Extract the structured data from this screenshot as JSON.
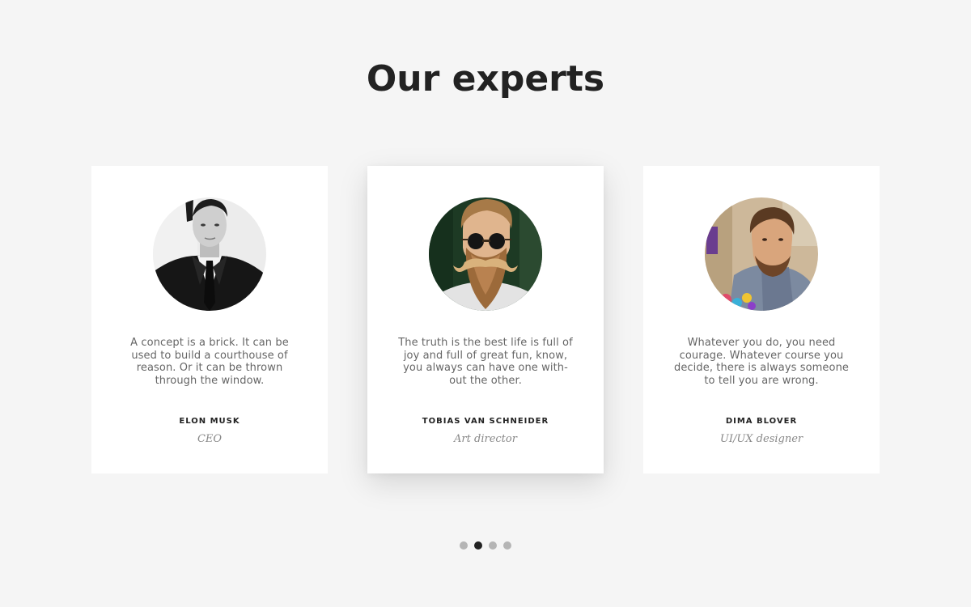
{
  "section": {
    "title": "Our experts"
  },
  "experts": [
    {
      "quote": "A concept is a brick. It can be used to build a courthouse of reason. Or it can be thrown through the window.",
      "name": "ELON MUSK",
      "role": "CEO"
    },
    {
      "quote": "The truth is the best life is full of joy and full of great fun, know, you always can have one with-out the other.",
      "name": "TOBIAS VAN SCHNEIDER",
      "role": "Art director"
    },
    {
      "quote": "Whatever you do, you need courage. Whatever course you decide, there is always someone to tell you are wrong.",
      "name": "DIMA BLOVER",
      "role": "UI/UX designer"
    }
  ],
  "pagination": {
    "total": 4,
    "active_index": 1
  },
  "colors": {
    "background": "#f5f5f5",
    "card": "#ffffff",
    "heading": "#222222",
    "body_text": "#666666",
    "role_text": "#888888",
    "dot_inactive": "#b5b5b5",
    "dot_active": "#222222"
  }
}
